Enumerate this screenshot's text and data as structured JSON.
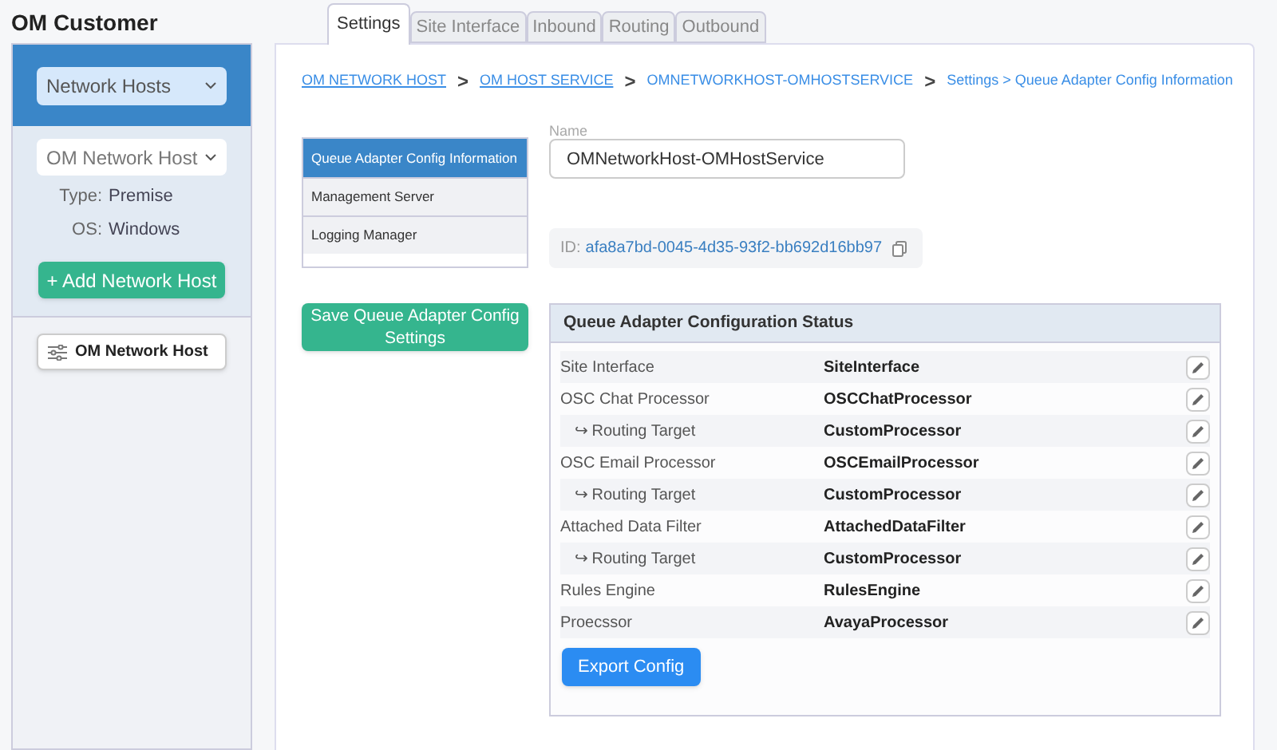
{
  "sidebar": {
    "title": "OM Customer",
    "category_select": {
      "value": "Network Hosts"
    },
    "host_select": {
      "value": "OM Network Host"
    },
    "details": [
      {
        "label": "Type:",
        "value": "Premise"
      },
      {
        "label": "OS:",
        "value": "Windows"
      }
    ],
    "add_button": "+ Add Network Host",
    "hosts": [
      {
        "label": "OM Network Host"
      }
    ]
  },
  "tabs": [
    {
      "label": "Settings",
      "selected": true
    },
    {
      "label": "Site Interface",
      "selected": false
    },
    {
      "label": "Inbound",
      "selected": false
    },
    {
      "label": "Routing",
      "selected": false
    },
    {
      "label": "Outbound",
      "selected": false
    }
  ],
  "breadcrumb": [
    {
      "label": "OM NETWORK HOST",
      "kind": "link"
    },
    {
      "label": ">",
      "kind": "sep"
    },
    {
      "label": "OM HOST SERVICE",
      "kind": "link"
    },
    {
      "label": ">",
      "kind": "sep"
    },
    {
      "label": "OMNETWORKHOST-OMHOSTSERVICE",
      "kind": "plain"
    },
    {
      "label": ">",
      "kind": "sep"
    },
    {
      "label": "Settings > Queue Adapter Config Information",
      "kind": "plain"
    }
  ],
  "sections": [
    {
      "label": "Queue Adapter Config Information",
      "selected": true
    },
    {
      "label": "Management Server",
      "selected": false
    },
    {
      "label": "Logging Manager",
      "selected": false
    }
  ],
  "name_field": {
    "label": "Name",
    "value": "OMNetworkHost-OMHostService"
  },
  "id": {
    "label": "ID:",
    "value": "afa8a7bd-0045-4d35-93f2-bb692d16bb97"
  },
  "save_button": "Save Queue Adapter Config Settings",
  "status": {
    "title": "Queue Adapter Configuration Status",
    "rows": [
      {
        "label": "Site Interface",
        "value": "SiteInterface",
        "kind": "main"
      },
      {
        "label": "OSC Chat Processor",
        "value": "OSCChatProcessor",
        "kind": "main"
      },
      {
        "label": "↪ Routing Target",
        "value": "CustomProcessor",
        "kind": "sub"
      },
      {
        "label": "OSC Email Processor",
        "value": "OSCEmailProcessor",
        "kind": "main"
      },
      {
        "label": "↪ Routing Target",
        "value": "CustomProcessor",
        "kind": "sub"
      },
      {
        "label": "Attached Data Filter",
        "value": "AttachedDataFilter",
        "kind": "main"
      },
      {
        "label": "↪ Routing Target",
        "value": "CustomProcessor",
        "kind": "sub"
      },
      {
        "label": "Rules Engine",
        "value": "RulesEngine",
        "kind": "main"
      },
      {
        "label": "Proecssor",
        "value": "AvayaProcessor",
        "kind": "main"
      }
    ],
    "export_button": "Export Config"
  }
}
